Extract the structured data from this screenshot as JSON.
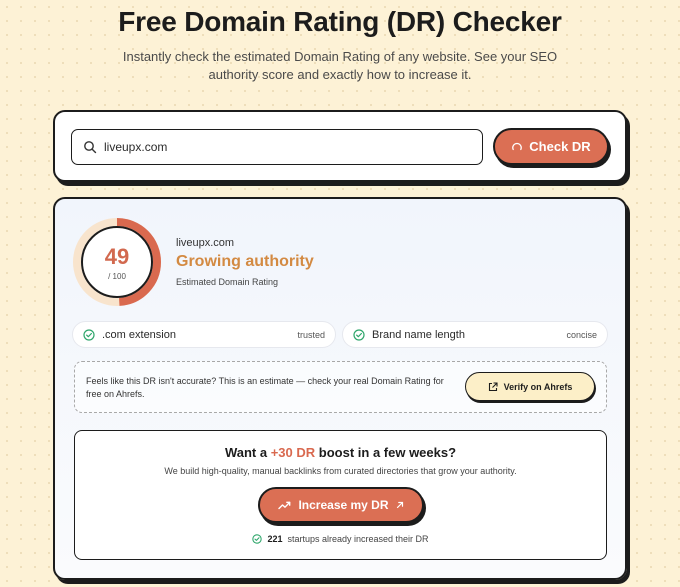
{
  "header": {
    "title": "Free Domain Rating (DR) Checker",
    "subtitle": "Instantly check the estimated Domain Rating of any website. See your SEO authority score and exactly how to increase it."
  },
  "search": {
    "value": "liveupx.com",
    "button_label": "Check DR"
  },
  "result": {
    "score": "49",
    "max": "/ 100",
    "score_fraction": 0.49,
    "domain": "liveupx.com",
    "authority_label": "Growing authority",
    "rating_caption": "Estimated Domain Rating",
    "signals": [
      {
        "label": ".com extension",
        "tag": "trusted"
      },
      {
        "label": "Brand name length",
        "tag": "concise"
      }
    ]
  },
  "verify": {
    "text": "Feels like this DR isn't accurate? This is an estimate — check your real Domain Rating for free on Ahrefs.",
    "button_label": "Verify on Ahrefs"
  },
  "boost": {
    "title_prefix": "Want a",
    "title_accent": "+30 DR",
    "title_suffix": "boost in a few weeks?",
    "description": "We build high-quality, manual backlinks from curated directories that grow your authority.",
    "button_label": "Increase my DR",
    "proof_count": "221",
    "proof_text": "startups already increased their DR"
  },
  "colors": {
    "accent": "#db6f54",
    "authority": "#d38a42",
    "check_green": "#2ea66b",
    "background": "#fdf2d6"
  },
  "icons": {
    "search": "search-icon",
    "check_button": "refresh-icon",
    "signal": "check-circle-icon",
    "verify": "external-link-icon",
    "increase": "trending-up-icon",
    "increase_arrow": "arrow-up-right-icon"
  }
}
